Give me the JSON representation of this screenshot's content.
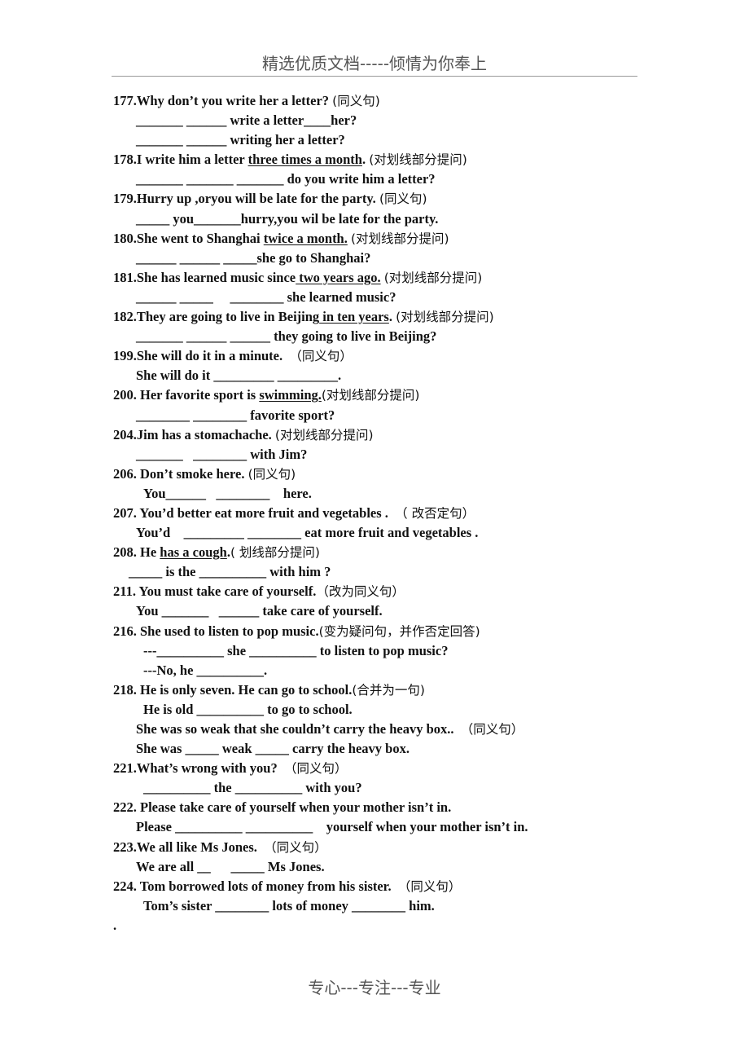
{
  "header": {
    "title": "精选优质文档-----倾情为你奉上"
  },
  "footer": {
    "text": "专心---专注---专业"
  },
  "items": [
    {
      "prompt": {
        "pre": "177.Why don’t you write her a letter? ",
        "underlined": "",
        "post": "",
        "tag": "(同义句)"
      },
      "answers": [
        "_______ ______ write a letter____her?",
        "_______ ______ writing her a letter?"
      ]
    },
    {
      "prompt": {
        "pre": "178.I write him a letter ",
        "underlined": "three times a month",
        "post": ". ",
        "tag": "(对划线部分提问)"
      },
      "answers": [
        "_______ _______ _______ do you write him a letter?"
      ]
    },
    {
      "prompt": {
        "pre": "179.Hurry up ,oryou will be late for the party. ",
        "underlined": "",
        "post": "",
        "tag": "(同义句)"
      },
      "answers": [
        "_____ you_______hurry,you wil be late for the party."
      ]
    },
    {
      "prompt": {
        "pre": "180.She went to Shanghai ",
        "underlined": "twice a month.",
        "post": " ",
        "tag": "(对划线部分提问)"
      },
      "answers": [
        "______ ______ _____she go to Shanghai?"
      ]
    },
    {
      "prompt": {
        "pre": "181.She has learned music since",
        "underlined": " two years ago.",
        "post": " ",
        "tag": "(对划线部分提问)"
      },
      "answers": [
        "______ _____     ________ she learned music?"
      ]
    },
    {
      "prompt": {
        "pre": "182.They are going to live in Beijing",
        "underlined": " in ten years",
        "post": ". ",
        "tag": "(对划线部分提问)"
      },
      "answers": [
        "_______ ______ ______ they going to live in Beijing?"
      ]
    },
    {
      "prompt": {
        "pre": "199.She will do it in a minute.  ",
        "underlined": "",
        "post": "",
        "tag": "（同义句）"
      },
      "answers": [
        "She will do it _________ _________."
      ]
    },
    {
      "prompt": {
        "pre": "200. Her favorite sport is ",
        "underlined": "swimming.",
        "post": "",
        "tag": "(对划线部分提问)"
      },
      "answers": [
        "________ ________ favorite sport?"
      ]
    },
    {
      "prompt": {
        "pre": "204.Jim has a stomachache. ",
        "underlined": "",
        "post": "",
        "tag": "(对划线部分提问)"
      },
      "answers": [
        "_______   ________ with Jim?"
      ]
    },
    {
      "prompt": {
        "pre": "206. Don’t smoke here. ",
        "underlined": "",
        "post": "",
        "tag": "(同义句)"
      },
      "answers": [
        "You______   ________    here."
      ]
    },
    {
      "prompt": {
        "pre": "207. You’d better eat more fruit and vegetables .  ",
        "underlined": "",
        "post": "",
        "tag": "（ 改否定句）"
      },
      "answers": [
        "You’d    _________ ________ eat more fruit and vegetables ."
      ]
    },
    {
      "prompt": {
        "pre": "208. He ",
        "underlined": "has a cough",
        "post": ".",
        "tag": "( 划线部分提问)"
      },
      "answers": [
        "_____ is the __________ with him ?"
      ]
    },
    {
      "prompt": {
        "pre": "211. You must take care of yourself.",
        "underlined": "",
        "post": "",
        "tag": "（改为同义句）"
      },
      "answers": [
        "You _______   ______ take care of yourself."
      ]
    },
    {
      "prompt": {
        "pre": "216. She used to listen to pop music.",
        "underlined": "",
        "post": "",
        "tag": "(变为疑问句，并作否定回答)"
      },
      "answers": [
        "---__________ she __________ to listen to pop music?",
        "---No, he __________."
      ]
    },
    {
      "prompt": {
        "pre": "218. He is only seven. He can go to school.",
        "underlined": "",
        "post": "",
        "tag": "(合并为一句)"
      },
      "answers": [
        "He is old __________ to go to school."
      ]
    }
  ],
  "extra_lines": {
    "weak_prompt": "She was so weak that she couldn’t carry the heavy box..  ",
    "weak_tag": "（同义句）",
    "weak_answer": "She was _____ weak _____ carry the heavy box."
  },
  "items2": [
    {
      "prompt": {
        "pre": "221.What’s wrong with you?  ",
        "tag": "（同义句）"
      },
      "answers": [
        "__________ the __________ with you?"
      ]
    },
    {
      "prompt": {
        "pre": "222. Please take care of yourself when your mother isn’t in.",
        "tag": ""
      },
      "answers": [
        "Please __________ __________    yourself when your mother isn’t in."
      ]
    },
    {
      "prompt": {
        "pre": "223.We all like Ms Jones.  ",
        "tag": "（同义句）"
      },
      "answers": [
        "We are all __      _____ Ms Jones."
      ]
    },
    {
      "prompt": {
        "pre": "224. Tom borrowed lots of money from his sister.  ",
        "tag": "（同义句）"
      },
      "answers": [
        "Tom’s sister ________ lots of money ________ him."
      ]
    }
  ],
  "trailing_mark": "."
}
